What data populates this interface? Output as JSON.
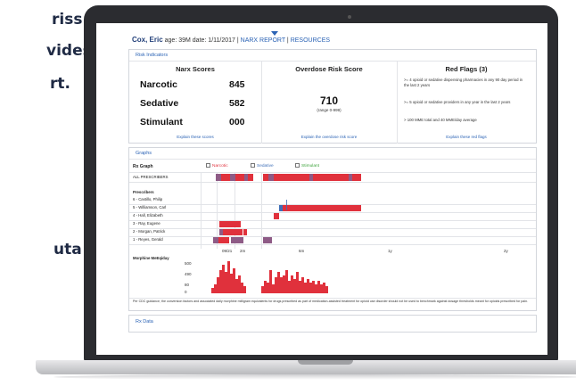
{
  "marketing": {
    "lines": [
      "riss",
      "vides",
      "rt.",
      "uta"
    ]
  },
  "header": {
    "patient_name": "Cox, Eric",
    "age": "age: 39M",
    "date": "date: 1/11/2017",
    "sep1": "|",
    "narx_report": "NARX REPORT",
    "sep2": "|",
    "resources": "RESOURCES"
  },
  "risk_indicators": {
    "title": "Risk Indicators",
    "narx_scores": {
      "heading": "Narx Scores",
      "rows": [
        {
          "label": "Narcotic",
          "value": "845"
        },
        {
          "label": "Sedative",
          "value": "582"
        },
        {
          "label": "Stimulant",
          "value": "000"
        }
      ],
      "link": "Explain these scores"
    },
    "overdose": {
      "heading": "Overdose Risk Score",
      "score": "710",
      "range": "(range 0-999)",
      "link": "Explain the overdose risk score"
    },
    "red_flags": {
      "heading": "Red Flags (3)",
      "items": [
        ">= 4 opioid or sedative dispensing pharmacies in any 90 day period in the last 2 years",
        ">= 5 opioid or sedative providers in any year in the last 2 years",
        "> 100 MME total and 40 MME/day average"
      ],
      "link": "Explain these red flags"
    }
  },
  "graphs": {
    "title": "Graphs",
    "rx_graph_label": "Rx Graph",
    "legend": [
      {
        "label": "Narcotic",
        "color": "#e0313c"
      },
      {
        "label": "Sedative",
        "color": "#3f6fb8"
      },
      {
        "label": "Stimulant",
        "color": "#3da33b"
      }
    ],
    "all_prescribers": "ALL PRESCRIBERS",
    "prescribers_heading": "Prescribers",
    "prescribers": [
      "6 - Castillo, Philip",
      "5 - Williamson, Carl",
      "4 - Hall, Elizabeth",
      "3 - Ray, Eugene",
      "2 - Morgan, Patrick",
      "1 - Reyes, Gerald"
    ],
    "time_ticks": [
      "09/21",
      "2m",
      "6m",
      "1y",
      "2y"
    ],
    "morphine_label": "Morphine MeEqiday",
    "morphine_ticks": [
      "500",
      "490",
      "80",
      "0"
    ],
    "footnote": "Per CDC guidance, the conversion factors and associated daily morphine milligram equivalents for drugs prescribed as part of medication-assisted treatment for opioid use disorder should not be used to benchmark against dosage thresholds meant for opioids prescribed for pain."
  },
  "rx_data": {
    "title": "Rx Data"
  },
  "colors": {
    "narcotic": "#e0313c",
    "sedative": "#3f6fb8",
    "stimulant": "#3da33b",
    "mixed": "#8e5b86",
    "link": "#2b63b5",
    "laptop_frame": "#2b2c30"
  }
}
